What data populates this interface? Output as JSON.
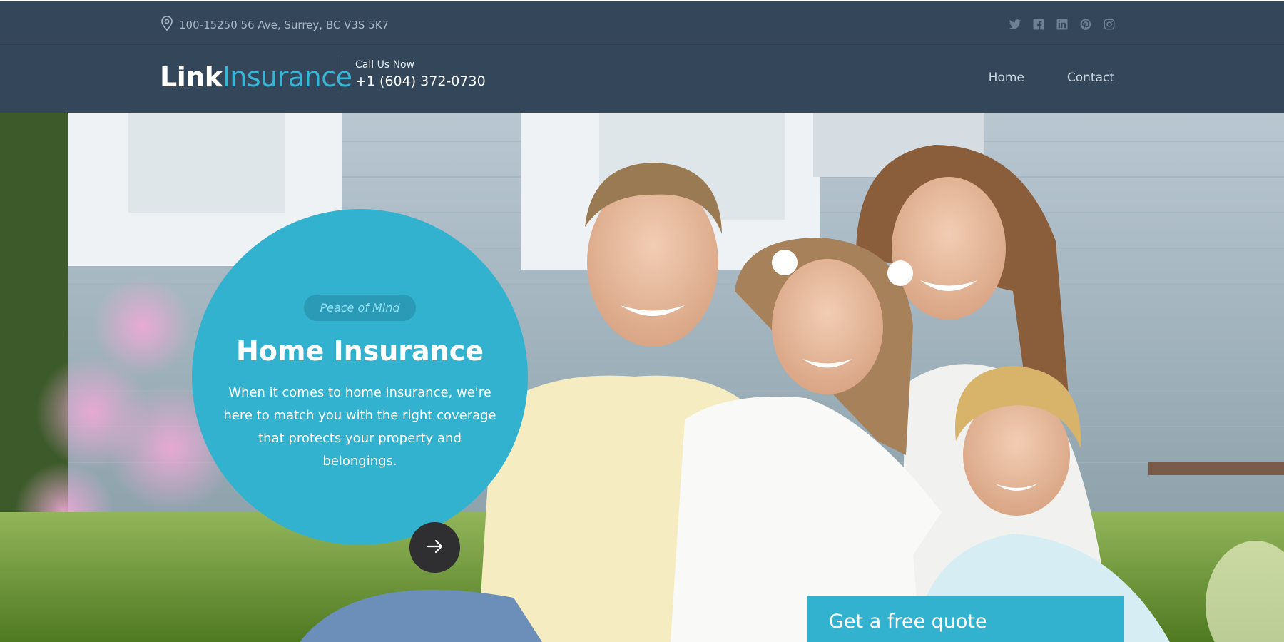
{
  "topbar": {
    "address": "100-15250 56 Ave, Surrey, BC V3S 5K7",
    "address_icon": "map-pin-icon",
    "socials": [
      "twitter-icon",
      "facebook-icon",
      "linkedin-icon",
      "pinterest-icon",
      "instagram-icon"
    ]
  },
  "header": {
    "logo_bold": "Link",
    "logo_light": "Insurance",
    "call_label": "Call Us Now",
    "phone": "+1 (604) 372-0730",
    "nav": [
      "Home",
      "Contact"
    ]
  },
  "hero": {
    "tag": "Peace of Mind",
    "title": "Home Insurance",
    "text": "When it comes to home insurance, we're here to match you with the right coverage that protects your property and belongings.",
    "next_icon": "arrow-right-icon",
    "quote_label": "Get a free quote"
  },
  "colors": {
    "header_bg": "#34465a",
    "accent": "#32b2cf",
    "dark_button": "#2f2f31"
  }
}
